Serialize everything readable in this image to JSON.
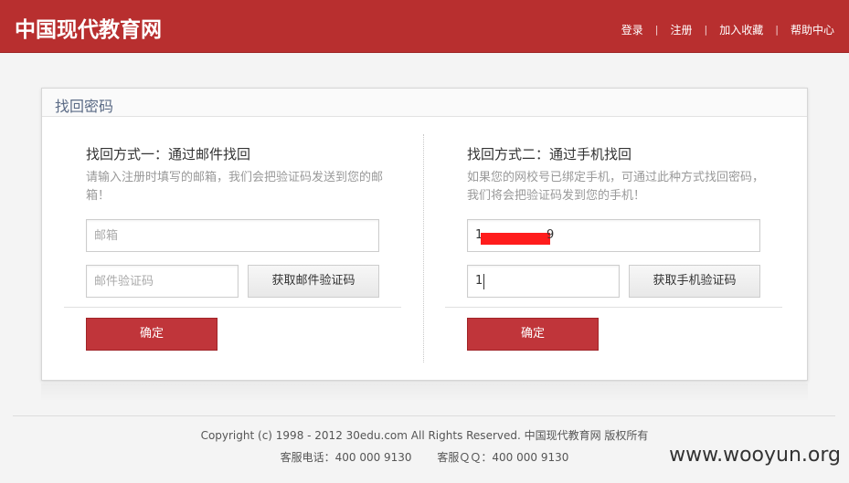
{
  "header": {
    "logo": "中国现代教育网",
    "nav": [
      "登录",
      "注册",
      "加入收藏",
      "帮助中心"
    ]
  },
  "panel": {
    "title": "找回密码"
  },
  "email_method": {
    "title": "找回方式一：通过邮件找回",
    "description": "请输入注册时填写的邮箱，我们会把验证码发送到您的邮箱！",
    "email_placeholder": "邮箱",
    "code_placeholder": "邮件验证码",
    "get_code_label": "获取邮件验证码",
    "submit_label": "确定"
  },
  "phone_method": {
    "title": "找回方式二：通过手机找回",
    "description": "如果您的网校号已绑定手机，可通过此种方式找回密码，我们将会把验证码发到您的手机！",
    "phone_prefix": "1",
    "phone_suffix": "9",
    "code_value": "1",
    "get_code_label": "获取手机验证码",
    "submit_label": "确定"
  },
  "footer": {
    "copyright": "Copyright (c) 1998 - 2012 30edu.com All Rights Reserved. 中国现代教育网 版权所有",
    "phone": "客服电话：400 000 9130",
    "qq": "客服ＱＱ：400 000 9130"
  },
  "watermark": "www.wooyun.org",
  "colors": {
    "brand_red": "#b82f2f",
    "button_red": "#c0353a",
    "redaction": "#ff1c1c"
  }
}
